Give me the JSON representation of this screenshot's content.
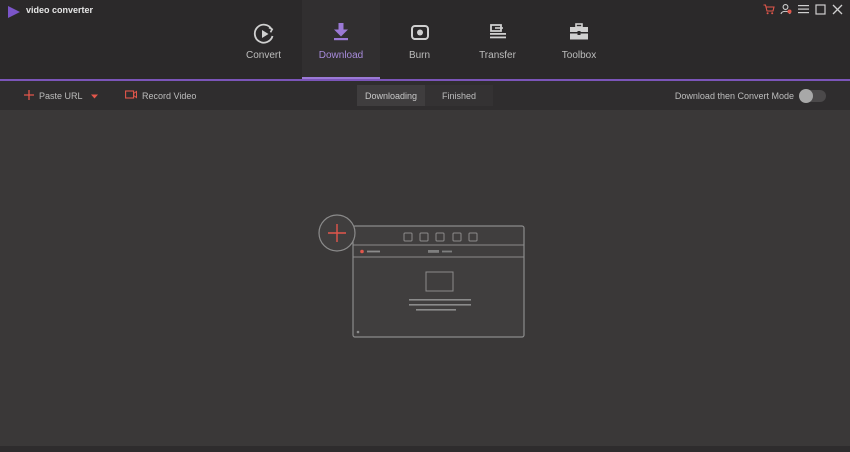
{
  "app": {
    "title": "video converter",
    "logo_icon": "play-triangle-icon"
  },
  "window_controls": [
    {
      "name": "cart-icon",
      "color": "#e2564b"
    },
    {
      "name": "account-icon",
      "color": "#e2564b"
    },
    {
      "name": "menu-icon",
      "color": "#cfcfcf"
    },
    {
      "name": "maximize-icon",
      "color": "#cfcfcf"
    },
    {
      "name": "close-icon",
      "color": "#cfcfcf"
    }
  ],
  "nav": {
    "active": "Download",
    "tabs": [
      {
        "label": "Convert",
        "icon": "convert-play-icon"
      },
      {
        "label": "Download",
        "icon": "download-arrow-icon"
      },
      {
        "label": "Burn",
        "icon": "burn-disc-icon"
      },
      {
        "label": "Transfer",
        "icon": "transfer-icon"
      },
      {
        "label": "Toolbox",
        "icon": "toolbox-icon"
      }
    ]
  },
  "toolbar": {
    "paste_url": "Paste URL",
    "record_video": "Record Video",
    "tabs": {
      "downloading": "Downloading",
      "finished": "Finished",
      "active": "Downloading"
    },
    "mode_label": "Download then Convert Mode",
    "mode_on": false
  },
  "main": {
    "empty_state_icon": "add-download-browser-icon"
  },
  "colors": {
    "accent": "#9b79d6",
    "red": "#e2564b",
    "background": "#3a3838",
    "header": "#2b292a"
  }
}
